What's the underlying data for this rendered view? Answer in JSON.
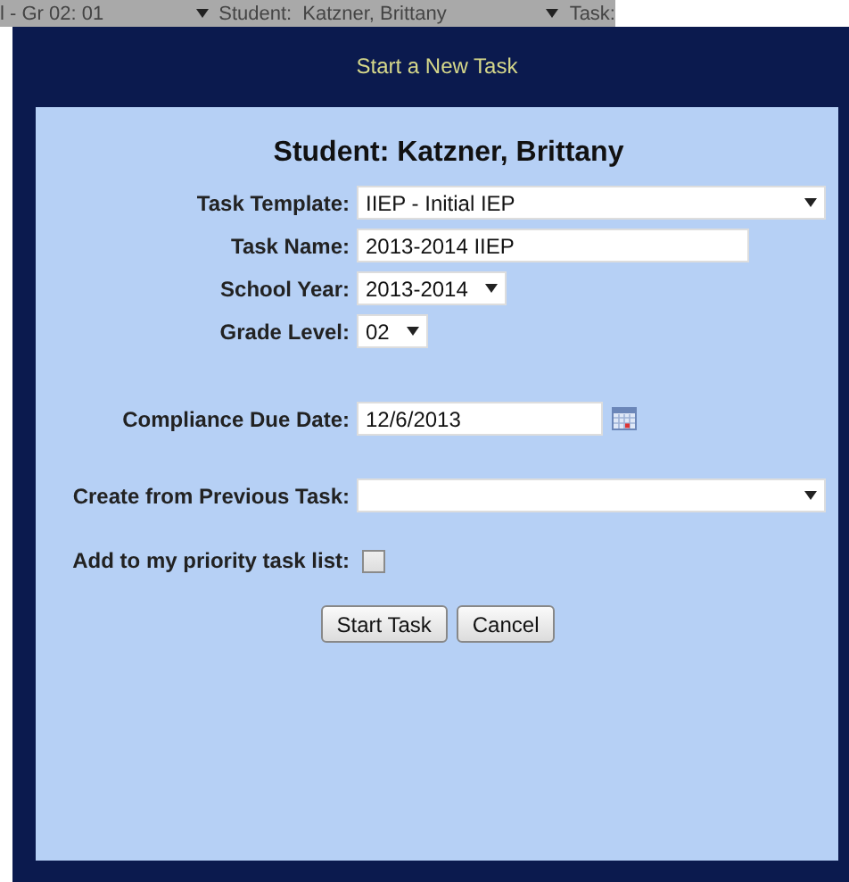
{
  "top_bar": {
    "grade": "l - Gr 02: 01",
    "student_label": "Student:",
    "student_name": "Katzner, Brittany",
    "task_label": "Task:"
  },
  "dialog": {
    "title": "Start a New Task",
    "heading": "Student: Katzner, Brittany",
    "sections": [
      [
        {
          "kind": "select",
          "label": "Task Template:",
          "value": "IIEP - Initial IEP",
          "wide": true
        },
        {
          "kind": "text",
          "label": "Task Name:",
          "value": "2013-2014 IIEP"
        },
        {
          "kind": "select",
          "label": "School Year:",
          "value": "2013-2014",
          "wide": false
        },
        {
          "kind": "select",
          "label": "Grade Level:",
          "value": "02",
          "wide": false
        }
      ],
      [
        {
          "kind": "date",
          "label": "Compliance Due Date:",
          "value": "12/6/2013"
        }
      ],
      [
        {
          "kind": "select",
          "label": "Create from Previous Task:",
          "wide": true
        }
      ],
      [
        {
          "kind": "checkbox",
          "label": "Add to my priority task list:",
          "checked": false
        }
      ]
    ],
    "buttons": [
      "Start Task",
      "Cancel"
    ]
  }
}
